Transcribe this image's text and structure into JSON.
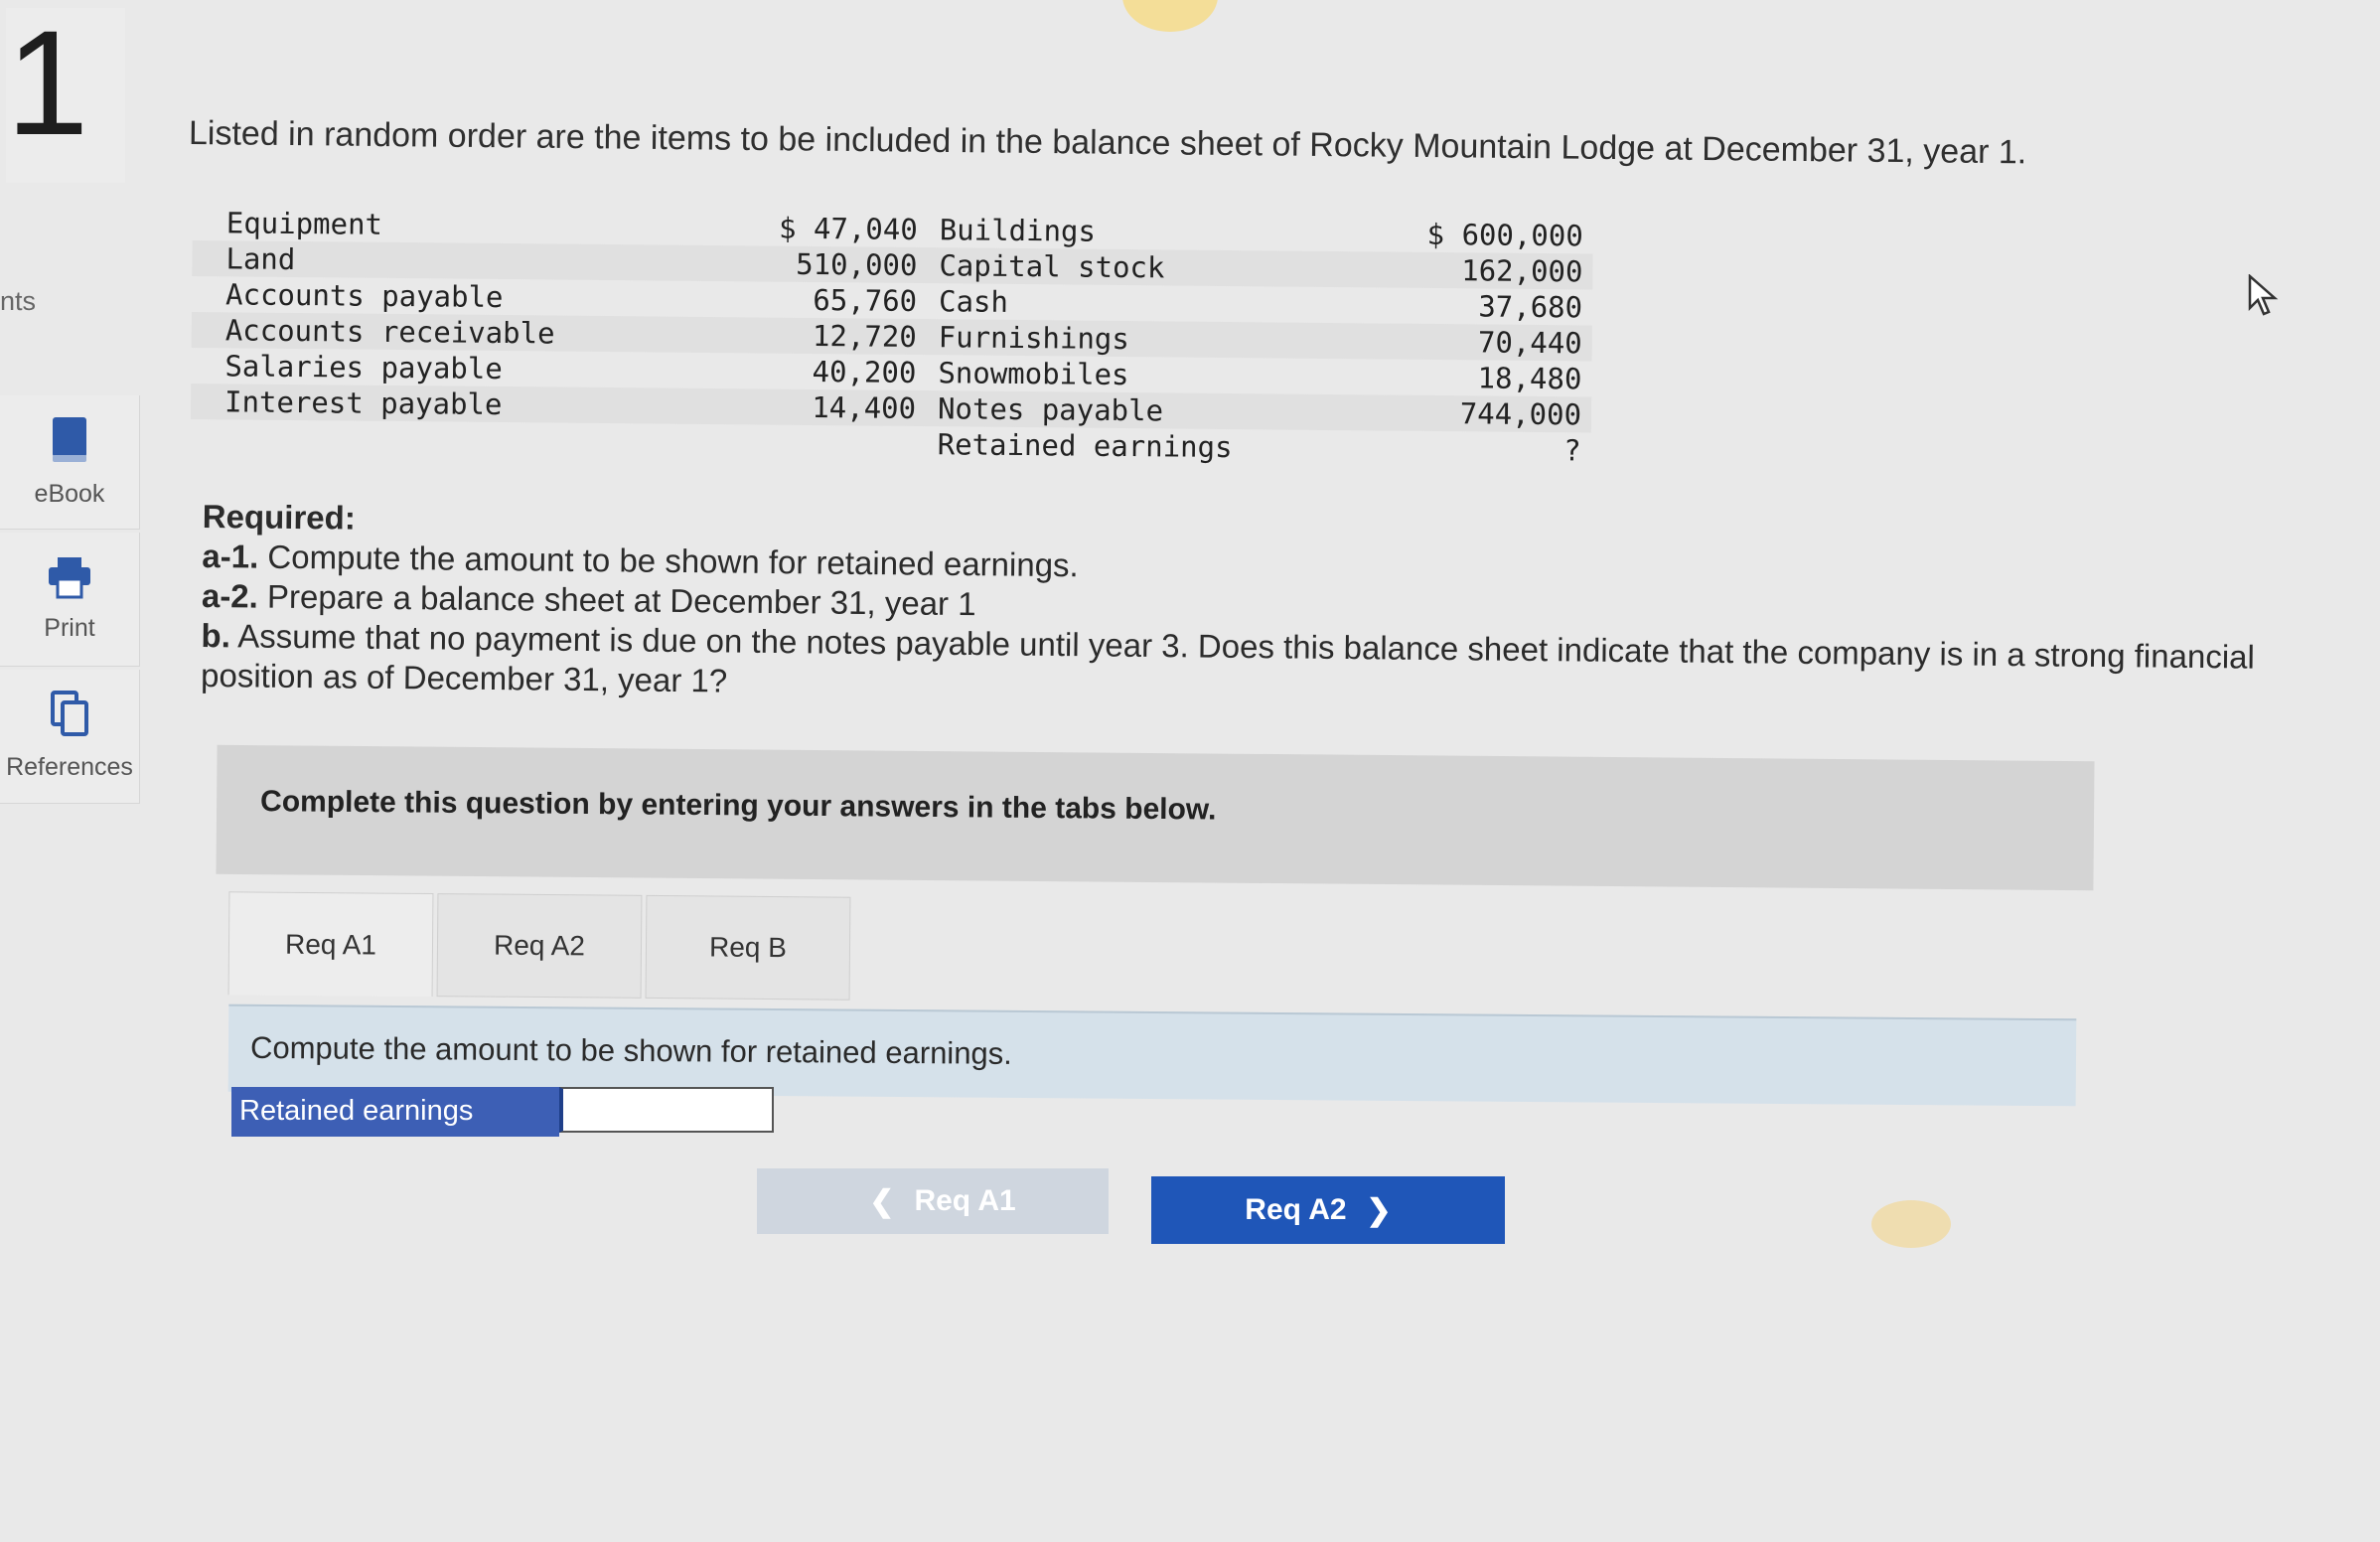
{
  "question_number": "1",
  "sidebar": {
    "cut_label": "nts",
    "tools": [
      {
        "label": "eBook",
        "icon": "book-icon"
      },
      {
        "label": "Print",
        "icon": "printer-icon"
      },
      {
        "label": "References",
        "icon": "copy-pages-icon"
      }
    ]
  },
  "intro": "Listed in random order are the items to be included in the balance sheet of Rocky Mountain Lodge at December 31, year 1.",
  "items": [
    {
      "left_label": "Equipment",
      "left_value": "$ 47,040",
      "right_label": "Buildings",
      "right_value": "$ 600,000"
    },
    {
      "left_label": "Land",
      "left_value": "510,000",
      "right_label": "Capital stock",
      "right_value": "162,000"
    },
    {
      "left_label": "Accounts payable",
      "left_value": "65,760",
      "right_label": "Cash",
      "right_value": "37,680"
    },
    {
      "left_label": "Accounts receivable",
      "left_value": "12,720",
      "right_label": "Furnishings",
      "right_value": "70,440"
    },
    {
      "left_label": "Salaries payable",
      "left_value": "40,200",
      "right_label": "Snowmobiles",
      "right_value": "18,480"
    },
    {
      "left_label": "Interest payable",
      "left_value": "14,400",
      "right_label": "Notes payable",
      "right_value": "744,000"
    },
    {
      "left_label": "",
      "left_value": "",
      "right_label": "Retained earnings",
      "right_value": "?"
    }
  ],
  "required": {
    "heading": "Required:",
    "a1_key": "a-1.",
    "a1_text": " Compute the amount to be shown for retained earnings.",
    "a2_key": "a-2.",
    "a2_text": " Prepare a balance sheet at December 31, year 1",
    "b_key": "b.",
    "b_text": " Assume that no payment is due on the notes payable until year 3. Does this balance sheet indicate that the company is in a strong financial position as of December 31, year 1?"
  },
  "instruction": "Complete this question by entering your answers in the tabs below.",
  "tabs": [
    "Req A1",
    "Req A2",
    "Req B"
  ],
  "active_tab": "Req A1",
  "prompt": "Compute the amount to be shown for retained earnings.",
  "answer": {
    "label": "Retained earnings",
    "value": ""
  },
  "nav": {
    "prev_label": "Req A1",
    "next_label": "Req A2",
    "prev_icon": "chevron-left-icon",
    "next_icon": "chevron-right-icon"
  },
  "colors": {
    "accent": "#1f56b8",
    "answer_label_bg": "#3d5fb5",
    "prompt_bg": "#d5e1ea"
  }
}
